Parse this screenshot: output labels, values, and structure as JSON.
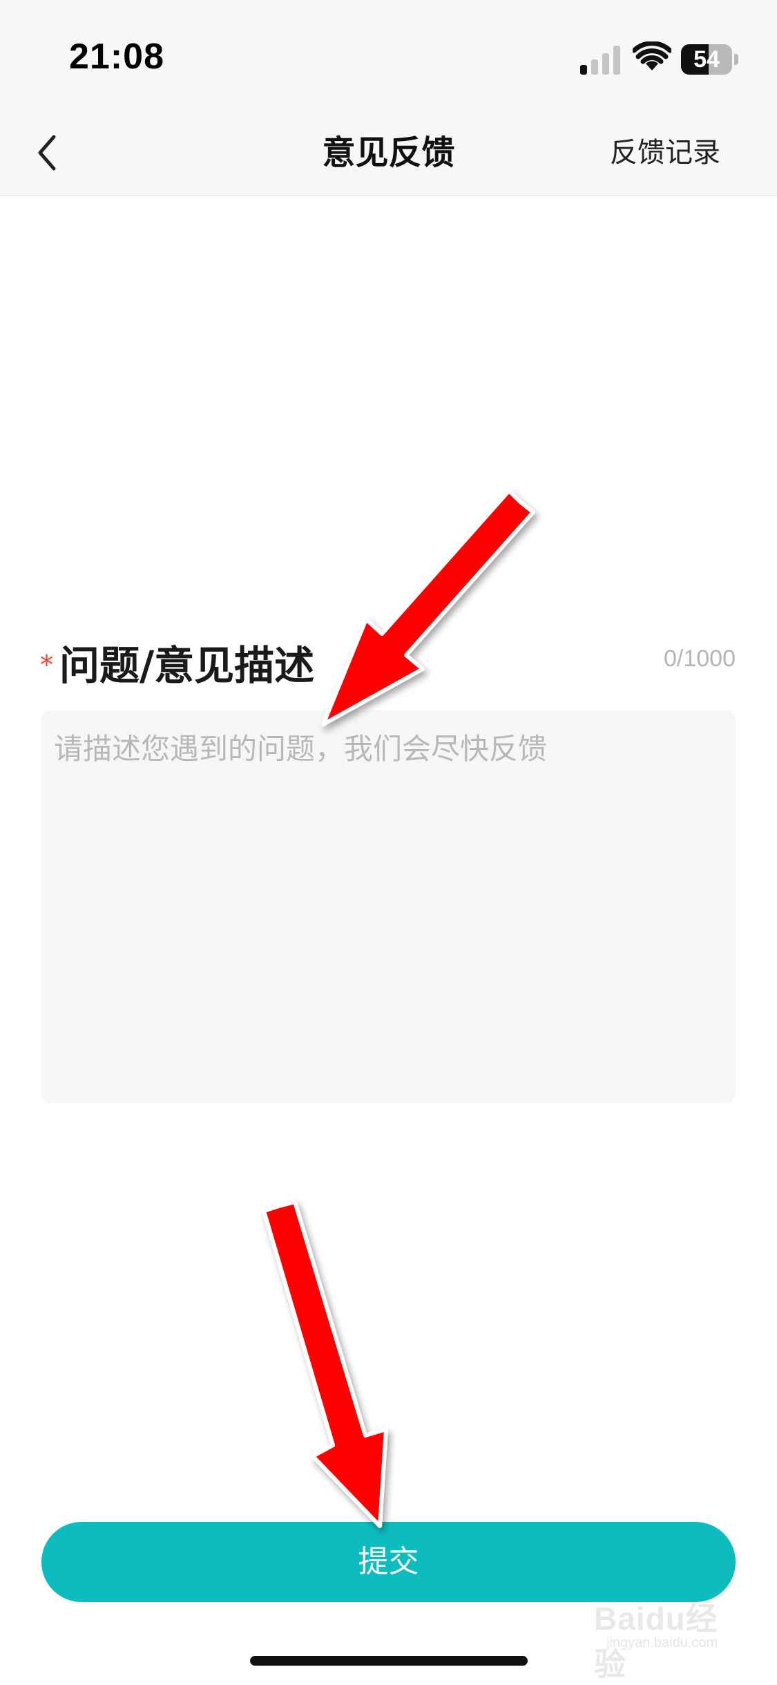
{
  "status_bar": {
    "time": "21:08",
    "battery_level": "54",
    "battery_fraction": 0.54,
    "signal_bars_active": 1,
    "signal_bars_total": 4,
    "icons": [
      "signal-icon",
      "wifi-icon",
      "battery-icon"
    ]
  },
  "nav": {
    "back_icon": "chevron-left-icon",
    "title": "意见反馈",
    "right_action": "反馈记录"
  },
  "form": {
    "required_mark": "*",
    "section_title": "问题/意见描述",
    "char_counter": "0/1000",
    "textarea_placeholder": "请描述您遇到的问题，我们会尽快反馈",
    "textarea_value": ""
  },
  "submit": {
    "label": "提交"
  },
  "colors": {
    "accent": "#0cbcbf",
    "required": "#ff3b30",
    "annotation_arrow": "#ff0000",
    "header_bg": "#f7f7f7",
    "input_bg": "#f5f6f8"
  },
  "watermark": {
    "brand": "Baidu经验",
    "domain": "jingyan.baidu.com"
  }
}
